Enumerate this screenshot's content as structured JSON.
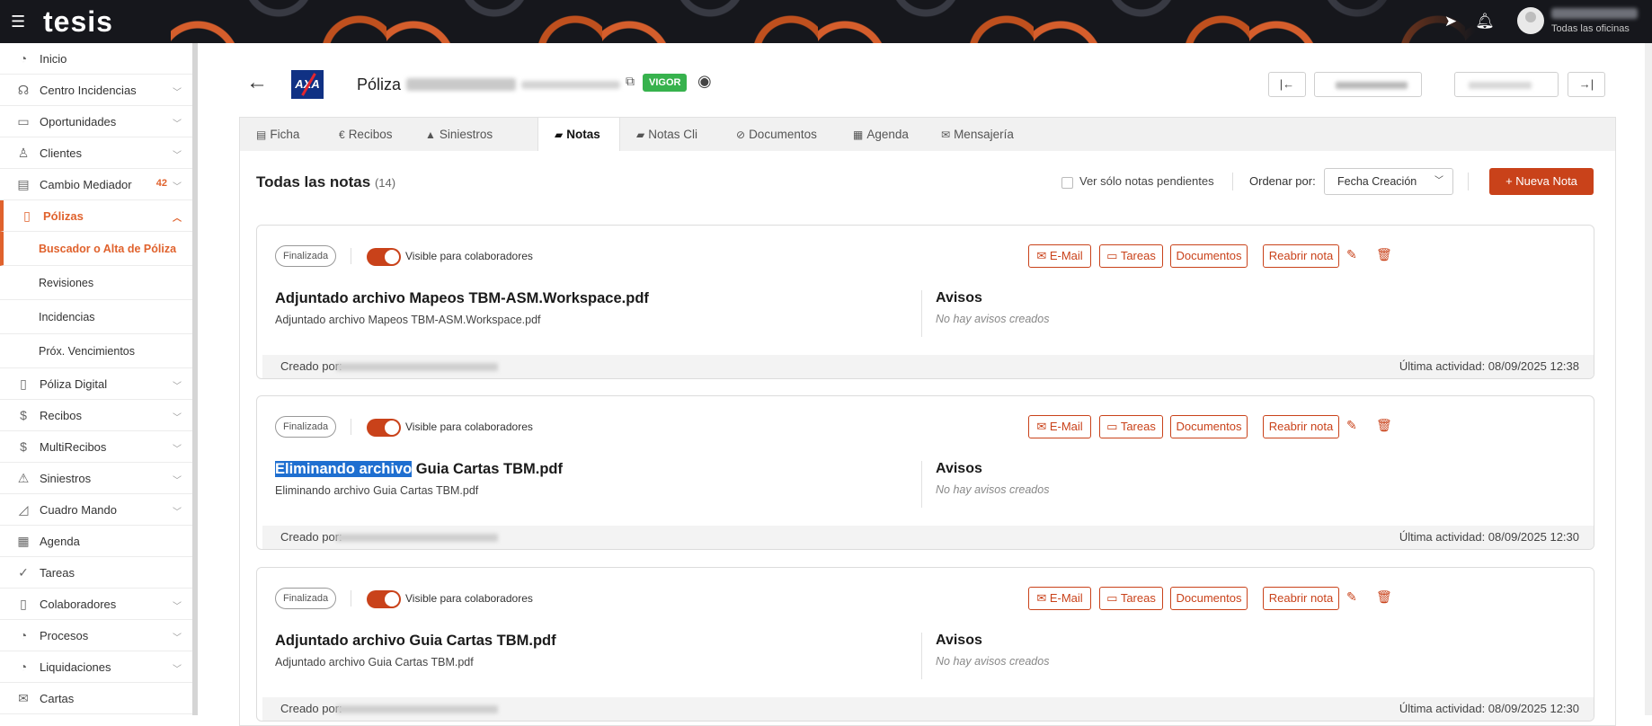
{
  "app": {
    "logo": "tesis",
    "office_label": "Todas las oficinas"
  },
  "sidebar": {
    "items": [
      {
        "label": "Inicio",
        "icon": "◔"
      },
      {
        "label": "Centro Incidencias",
        "icon": "☊"
      },
      {
        "label": "Oportunidades",
        "icon": "▭"
      },
      {
        "label": "Clientes",
        "icon": "♙"
      },
      {
        "label": "Cambio Mediador",
        "icon": "▤",
        "badge": "42"
      },
      {
        "label": "Pólizas",
        "icon": "▯"
      },
      {
        "label": "Póliza Digital",
        "icon": "▯"
      },
      {
        "label": "Recibos",
        "icon": "$"
      },
      {
        "label": "MultiRecibos",
        "icon": "$"
      },
      {
        "label": "Siniestros",
        "icon": "⚠"
      },
      {
        "label": "Cuadro Mando",
        "icon": "◿"
      },
      {
        "label": "Agenda",
        "icon": "▦"
      },
      {
        "label": "Tareas",
        "icon": "✓"
      },
      {
        "label": "Colaboradores",
        "icon": "▯"
      },
      {
        "label": "Procesos",
        "icon": "◔"
      },
      {
        "label": "Liquidaciones",
        "icon": "◔"
      },
      {
        "label": "Cartas",
        "icon": "✉"
      }
    ],
    "subitems": [
      {
        "label": "Buscador o Alta de Póliza"
      },
      {
        "label": "Revisiones"
      },
      {
        "label": "Incidencias"
      },
      {
        "label": "Próx. Vencimientos"
      }
    ]
  },
  "header": {
    "insurer_logo": "AXA",
    "title": "Póliza",
    "status": "VIGOR"
  },
  "tabs": [
    {
      "label": "Ficha",
      "icon": "▤"
    },
    {
      "label": "Recibos",
      "icon": "€"
    },
    {
      "label": "Siniestros",
      "icon": "▲"
    },
    {
      "label": "Notas",
      "icon": "▰"
    },
    {
      "label": "Notas Cli",
      "icon": "▰"
    },
    {
      "label": "Documentos",
      "icon": "⊘"
    },
    {
      "label": "Agenda",
      "icon": "▦"
    },
    {
      "label": "Mensajería",
      "icon": "✉"
    }
  ],
  "notes_section": {
    "title": "Todas las notas",
    "count": "(14)",
    "pending_only_label": "Ver sólo notas pendientes",
    "order_label": "Ordenar por:",
    "order_value": "Fecha Creación",
    "new_note_label": "+ Nueva Nota"
  },
  "card_actions": {
    "status": "Finalizada",
    "visible_label": "Visible para colaboradores",
    "email_label": "✉ E-Mail",
    "tasks_label": "▭ Tareas",
    "docs_label": "Documentos",
    "reopen_label": "Reabrir nota",
    "avisos_title": "Avisos",
    "avisos_empty": "No hay avisos creados",
    "created_by_label": "Creado por:"
  },
  "notes": [
    {
      "title": "Adjuntado archivo Mapeos TBM-ASM.Workspace.pdf",
      "description": "Adjuntado archivo Mapeos TBM-ASM.Workspace.pdf",
      "last_activity": "Última actividad: 08/09/2025 12:38"
    },
    {
      "title_highlight": "Eliminando archivo",
      "title_rest": " Guia Cartas TBM.pdf",
      "description": "Eliminando archivo Guia Cartas TBM.pdf",
      "last_activity": "Última actividad: 08/09/2025 12:30"
    },
    {
      "title": "Adjuntado archivo Guia Cartas TBM.pdf",
      "description": "Adjuntado archivo Guia Cartas TBM.pdf",
      "last_activity": "Última actividad: 08/09/2025 12:30"
    }
  ],
  "colors": {
    "accent": "#c9421a",
    "sidebar_accent": "#e0622d",
    "vigor": "#37b24d",
    "topbar": "#16171c"
  }
}
